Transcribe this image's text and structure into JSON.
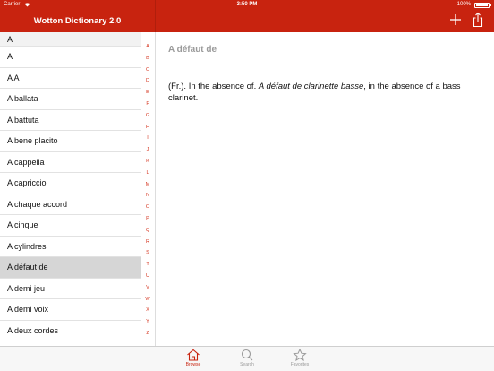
{
  "status_bar": {
    "carrier": "Carrier",
    "time": "3:50 PM",
    "battery": "100%"
  },
  "nav": {
    "title": "Wotton Dictionary 2.0",
    "add_icon": "plus-icon",
    "share_icon": "share-icon"
  },
  "list": {
    "section_header": "A",
    "items": [
      "A",
      "A A",
      "A ballata",
      "A battuta",
      "A bene placito",
      "A cappella",
      "A capriccio",
      "A chaque accord",
      "A cinque",
      "A cylindres",
      "A défaut de",
      "A demi jeu",
      "A demi voix",
      "A deux cordes"
    ],
    "selected": "A défaut de"
  },
  "index_letters": [
    "A",
    "B",
    "C",
    "D",
    "E",
    "F",
    "G",
    "H",
    "I",
    "J",
    "K",
    "L",
    "M",
    "N",
    "O",
    "P",
    "Q",
    "R",
    "S",
    "T",
    "U",
    "V",
    "W",
    "X",
    "Y",
    "Z"
  ],
  "detail": {
    "title": "A défaut de",
    "body_prefix": "(Fr.). In the absence of. ",
    "body_italic": "A défaut de clarinette basse",
    "body_suffix": ", in the absence of a bass clarinet."
  },
  "tabs": [
    {
      "label": "Browse",
      "icon": "home-icon",
      "active": true
    },
    {
      "label": "Search",
      "icon": "search-icon",
      "active": false
    },
    {
      "label": "Favorites",
      "icon": "star-icon",
      "active": false
    }
  ],
  "colors": {
    "accent": "#c8230f",
    "selected_row": "#d6d6d6",
    "detail_title": "#9a9a9a"
  }
}
